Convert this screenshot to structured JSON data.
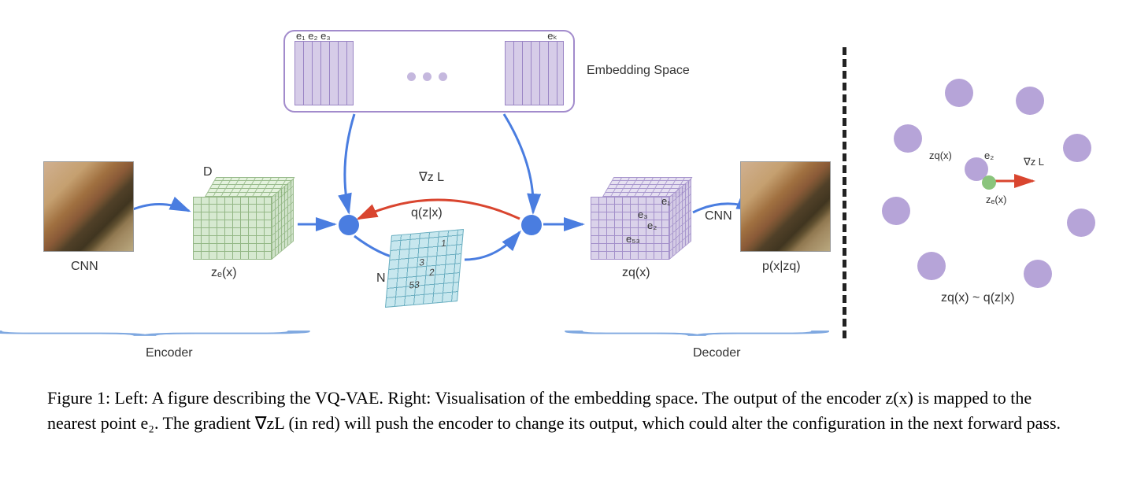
{
  "caption": "Figure 1: Left: A figure describing the VQ-VAE. Right: Visualisation of the embedding space. The output of the encoder z(x) is mapped to the nearest point e₂. The gradient ∇zL (in red) will push the encoder to change its output, which could alter the configuration in the next forward pass.",
  "left": {
    "encoder": {
      "label": "Encoder",
      "cnn": "CNN",
      "d": "D",
      "ze": "zₑ(x)"
    },
    "codebook": {
      "label": "Embedding Space",
      "indices": "e₁ e₂ e₃",
      "last": "eₖ"
    },
    "quant": {
      "q": "q(z|x)",
      "grad": "∇z L",
      "n": "N",
      "cells": [
        "1",
        "3",
        "2",
        "53"
      ]
    },
    "decoder_cube": {
      "zq": "zq(x)",
      "e1": "e₁",
      "e2": "e₂",
      "e3": "e₃",
      "e53": "e₅₃"
    },
    "decoder": {
      "label": "Decoder",
      "cnn": "CNN",
      "px": "p(x|zq)"
    }
  },
  "right": {
    "zq": "zq(x)",
    "e2": "e₂",
    "grad": "∇z L",
    "ze": "zₑ(x)",
    "sample": "zq(x) ~ q(z|x)"
  }
}
